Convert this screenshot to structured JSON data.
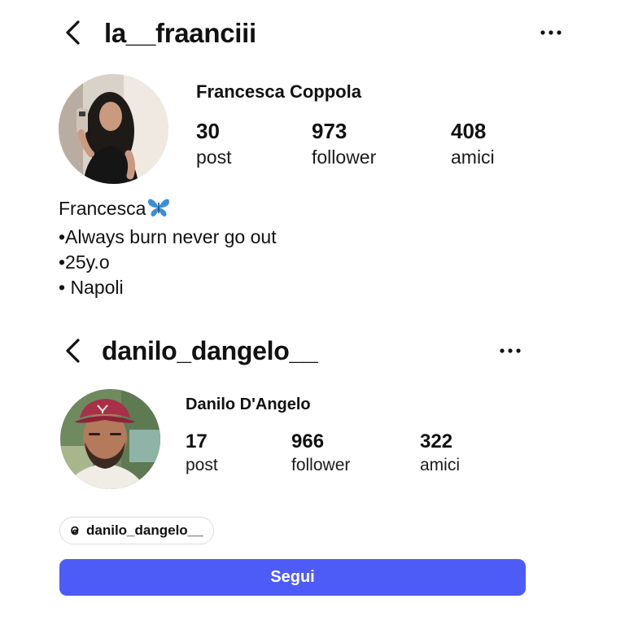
{
  "profile1": {
    "username": "la__fraanciii",
    "full_name": "Francesca Coppola",
    "stats": [
      {
        "value": "30",
        "label": "post"
      },
      {
        "value": "973",
        "label": "follower"
      },
      {
        "value": "408",
        "label": "amici"
      }
    ],
    "bio": {
      "name_line": "Francesca",
      "lines": [
        "•Always burn never go out",
        "•25y.o",
        "• Napoli"
      ]
    },
    "icons": {
      "back": "chevron-left-icon",
      "more": "more-horizontal-icon",
      "bio_emoji": "blue-butterfly-icon"
    }
  },
  "profile2": {
    "username": "danilo_dangelo__",
    "full_name": "Danilo D'Angelo",
    "stats": [
      {
        "value": "17",
        "label": "post"
      },
      {
        "value": "966",
        "label": "follower"
      },
      {
        "value": "322",
        "label": "amici"
      }
    ],
    "threads_handle": "danilo_dangelo__",
    "follow_label": "Segui",
    "icons": {
      "back": "chevron-left-icon",
      "more": "more-horizontal-icon",
      "threads": "threads-icon"
    }
  },
  "colors": {
    "follow_button": "#4e5cf7",
    "text": "#111111",
    "butterfly": "#3a8fd9"
  }
}
